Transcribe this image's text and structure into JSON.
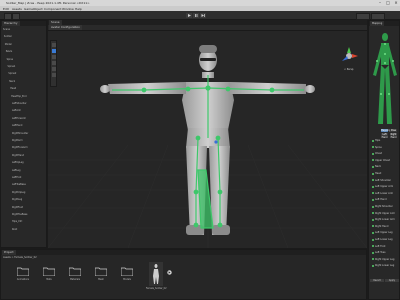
{
  "window": {
    "title": "Soldier_Map | Zcas - Peep 2021.1.4f1 Personal <DX11>"
  },
  "menu": [
    "Edit",
    "Assets",
    "GameObject",
    "Component",
    "Window",
    "Help"
  ],
  "tabs": {
    "hierarchy": "Hierarchy",
    "scene": "Scene",
    "avatar": "Avatar Configuration"
  },
  "hierarchy": {
    "rows": [
      "Scene",
      "Soldier",
      "Model",
      "Pelvis",
      "Spine",
      "Spine1",
      "Spine2",
      "Neck",
      "Head",
      "HeadTop_End",
      "LeftShoulder",
      "LeftArm",
      "LeftForeArm",
      "LeftHand",
      "RightShoulder",
      "RightArm",
      "RightForeArm",
      "RightHand",
      "LeftUpLeg",
      "LeftLeg",
      "LeftFoot",
      "LeftToeBase",
      "RightUpLeg",
      "RightLeg",
      "RightFoot",
      "RightToeBase",
      "Hips_Ctrl",
      "Root"
    ]
  },
  "inspector": {
    "header": "Mapping",
    "buttons": [
      "Mapping",
      "Pose",
      "Left Hand",
      "Right Hand"
    ],
    "sections": [
      "Body",
      "Head",
      "Left Arm",
      "Right Arm",
      "Left Leg",
      "Right Leg"
    ],
    "bones": [
      "Hips",
      "Spine",
      "Chest",
      "Upper Chest",
      "Neck",
      "Head",
      "Left Shoulder",
      "Left Upper Arm",
      "Left Lower Arm",
      "Left Hand",
      "Right Shoulder",
      "Right Upper Arm",
      "Right Lower Arm",
      "Right Hand",
      "Left Upper Leg",
      "Left Lower Leg",
      "Left Foot",
      "Left Toes",
      "Right Upper Leg",
      "Right Lower Leg"
    ],
    "footer": [
      "Revert",
      "Apply"
    ]
  },
  "scene": {
    "persp": "< Persp"
  },
  "project": {
    "tab": "Project",
    "breadcrumb": "Assets > Female_Soldier_02",
    "items": [
      "Animations",
      "Mats",
      "Materials",
      "Mesh",
      "Models",
      "Textures",
      "Female_Soldier_02"
    ]
  },
  "colors": {
    "accent": "#3a7bd5",
    "bone": "#3ec76a",
    "bg": "#1b1b1b"
  }
}
